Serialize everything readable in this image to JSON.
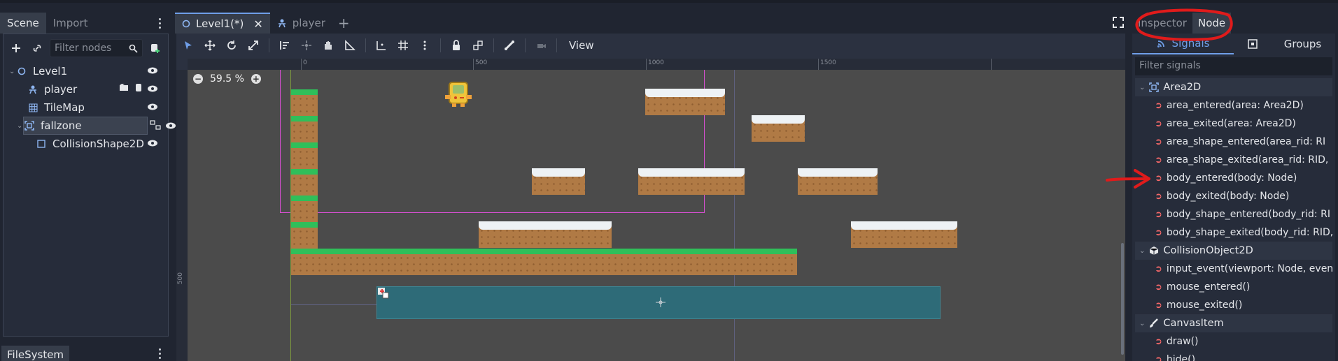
{
  "scene_dock": {
    "tabs": [
      "Scene",
      "Import"
    ],
    "filter_placeholder": "Filter nodes",
    "tree": [
      {
        "label": "Level1"
      },
      {
        "label": "player"
      },
      {
        "label": "TileMap"
      },
      {
        "label": "fallzone"
      },
      {
        "label": "CollisionShape2D"
      }
    ]
  },
  "filesystem_dock": {
    "tab": "FileSystem"
  },
  "editor": {
    "scene_tabs": [
      {
        "label": "Level1(*)",
        "active": true
      },
      {
        "label": "player",
        "active": false
      }
    ],
    "view_menu": "View",
    "zoom_label": "59.5 %",
    "ruler_labels": [
      "0",
      "500",
      "1000",
      "1500"
    ],
    "ruler_left_label": "500"
  },
  "inspector_dock": {
    "tabs": [
      "Inspector",
      "Node"
    ],
    "subtabs": [
      "Signals",
      "Groups"
    ],
    "filter_placeholder": "Filter signals",
    "groups": [
      {
        "name": "Area2D",
        "signals": [
          "area_entered(area: Area2D)",
          "area_exited(area: Area2D)",
          "area_shape_entered(area_rid: RI",
          "area_shape_exited(area_rid: RID,",
          "body_entered(body: Node)",
          "body_exited(body: Node)",
          "body_shape_entered(body_rid: RI",
          "body_shape_exited(body_rid: RID,"
        ]
      },
      {
        "name": "CollisionObject2D",
        "signals": [
          "input_event(viewport: Node, even",
          "mouse_entered()",
          "mouse_exited()"
        ]
      },
      {
        "name": "CanvasItem",
        "signals": [
          "draw()",
          "hide()"
        ]
      }
    ]
  },
  "colors": {
    "accent": "#6f9ee8",
    "signal_icon": "#ff6b6b",
    "annotation": "#e01b1b",
    "area_fill": "#2e6b78"
  }
}
